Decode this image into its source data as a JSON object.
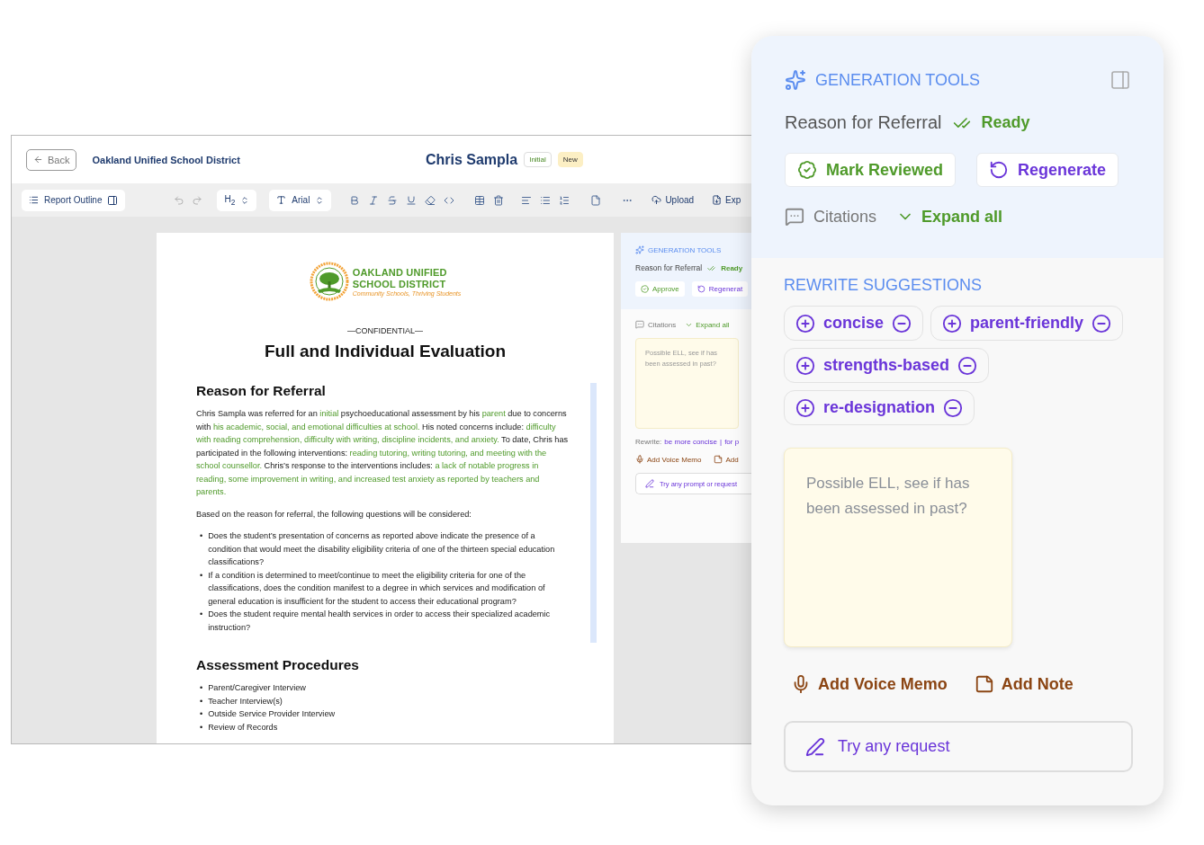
{
  "editor": {
    "back_button": "Back",
    "district": "Oakland Unified School District",
    "student": "Chris Sampla",
    "badges": [
      {
        "label": "Initial",
        "kind": "outline"
      },
      {
        "label": "New",
        "kind": "filled"
      }
    ],
    "toolbar": {
      "outline_button": "Report Outline",
      "heading_select": "H$_{2}$",
      "font_select": "Arial",
      "upload_button": "Upload",
      "export_button": "Exp"
    },
    "document": {
      "logo": {
        "line_1": "OAKLAND UNIFIED",
        "line_2": "SCHOOL DISTRICT",
        "tagline": "Community Schools, Thriving Students"
      },
      "confidential": "—CONFIDENTIAL—",
      "title": "Full and Individual Evaluation",
      "sections": [
        {
          "heading": "Reason for Referral",
          "active": true,
          "blocks": [
            {
              "kind": "paragraph",
              "segments": [
                {
                  "text": "Chris Sampla was referred for an ",
                  "highlighted": false
                },
                {
                  "text": "initial",
                  "highlighted": true
                },
                {
                  "text": " psychoeducational assessment by his ",
                  "highlighted": false
                },
                {
                  "text": "parent",
                  "highlighted": true
                },
                {
                  "text": " due to concerns with ",
                  "highlighted": false
                },
                {
                  "text": "his academic, social, and emotional difficulties at school.",
                  "highlighted": true
                },
                {
                  "text": " His noted concerns include: ",
                  "highlighted": false
                },
                {
                  "text": "difficulty with reading comprehension, difficulty with writing, discipline incidents, and anxiety.",
                  "highlighted": true
                },
                {
                  "text": " To date, Chris has participated in the following interventions: ",
                  "highlighted": false
                },
                {
                  "text": "reading tutoring, writing tutoring, and meeting with the school counsellor.",
                  "highlighted": true
                },
                {
                  "text": " Chris’s response to the interventions includes: ",
                  "highlighted": false
                },
                {
                  "text": "a lack of notable progress in reading, some improvement in writing, and increased test anxiety as reported by teachers and parents.",
                  "highlighted": true
                }
              ]
            },
            {
              "kind": "paragraph",
              "segments": [
                {
                  "text": "Based on the reason for referral, the following questions will be considered:",
                  "highlighted": false
                }
              ]
            },
            {
              "kind": "list",
              "bullet": "•",
              "items": [
                "Does the student’s presentation of concerns as reported above indicate the presence of a condition that would meet the disability eligibility criteria of one of the thirteen special education classifications?",
                "If a condition is determined to meet/continue to meet the eligibility criteria for one of the classifications, does the condition manifest to a degree in which services and modification of general education is insufficient for the student to access their educational program?",
                "Does the student require mental health services in order to access their specialized academic instruction?"
              ]
            }
          ]
        },
        {
          "heading": "Assessment Procedures",
          "active": false,
          "blocks": [
            {
              "kind": "list",
              "bullet": "•",
              "items": [
                "Parent/Caregiver Interview",
                "Teacher Interview(s)",
                "Outside Service Provider Interview",
                "Review of Records"
              ]
            }
          ]
        }
      ]
    },
    "side_panel": {
      "title": "GENERATION TOOLS",
      "section": "Reason for Referral",
      "status": "Ready",
      "buttons": [
        {
          "label": "Approve",
          "kind": "approve"
        },
        {
          "label": "Regenerat",
          "kind": "regenerate"
        }
      ],
      "citations": "Citations",
      "expand": "Expand all",
      "note": "Possible ELL, see if has been assessed in past?",
      "rewrite_label": "Rewrite:",
      "rewrite_links": [
        "be more concise",
        "for p"
      ],
      "rewrite_separator": "|",
      "actions": [
        {
          "label": "Add Voice Memo",
          "kind": "voice"
        },
        {
          "label": "Add",
          "kind": "note"
        }
      ],
      "prompt_placeholder": "Try any prompt or request"
    }
  },
  "generation_panel": {
    "title": "GENERATION TOOLS",
    "section": "Reason for Referral",
    "status": "Ready",
    "buttons": [
      {
        "label": "Mark Reviewed",
        "kind": "approve"
      },
      {
        "label": "Regenerate",
        "kind": "regenerate"
      }
    ],
    "citations": "Citations",
    "expand": "Expand all",
    "suggestions_title": "REWRITE SUGGESTIONS",
    "suggestions": [
      "concise",
      "parent-friendly",
      "strengths-based",
      "re-designation"
    ],
    "note": "Possible ELL, see if has been assessed in past?",
    "actions": [
      {
        "label": "Add Voice Memo",
        "kind": "voice"
      },
      {
        "label": "Add Note",
        "kind": "note"
      }
    ],
    "request_placeholder": "Try any request"
  }
}
